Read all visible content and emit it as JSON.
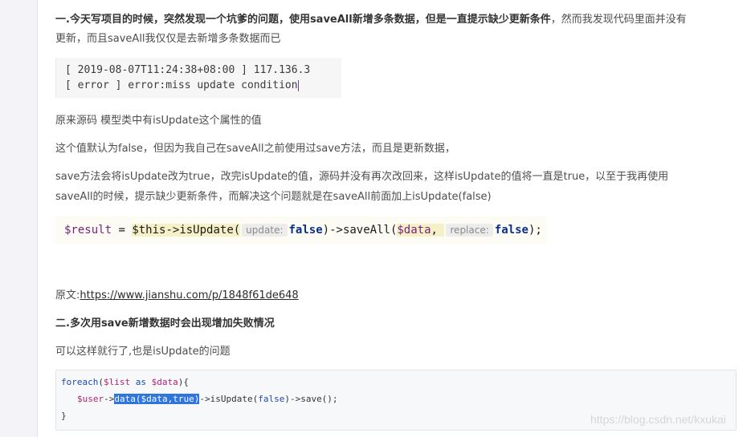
{
  "paragraphs": {
    "p1_bold": "一.今天写项目的时候，突然发现一个坑爹的问题，使用saveAll新增多条数据，但是一直提示缺少更新条件",
    "p1_rest": "，然而我发现代码里面并没有",
    "p1_line2": "更新，而且saveAll我仅仅是去新增多条数据而已",
    "p2": "原来源码 模型类中有isUpdate这个属性的值",
    "p3": "这个值默认为false，但因为我自己在saveAll之前使用过save方法，而且是更新数据，",
    "p4_line1": "save方法会将isUpdate改为true，改完isUpdate的值，源码并没有再次改回来，这样isUpdate的值将一直是true，以至于我再使用",
    "p4_line2": "saveAll的时候，提示缺少更新条件，而解决这个问题就是在saveAll前面加上isUpdate(false)",
    "source_label": "原文:",
    "source_url": "https://www.jianshu.com/p/1848f61de648",
    "heading2": "二.多次用save新增数据时会出现增加失败情况",
    "p5": "可以这样就行了,也是isUpdate的问题"
  },
  "log_block": {
    "line1": "[ 2019-08-07T11:24:38+08:00 ] 117.136.3",
    "line2": "[ error ] error:miss update condition"
  },
  "snippet": {
    "result_var": "$result",
    "equals": " = ",
    "this_call": "$this->isUpdate(",
    "hint_update": "update:",
    "false1": "false",
    "mid": ")->saveAll(",
    "data_var": "$data",
    "comma": ", ",
    "hint_replace": "replace:",
    "false2": "false",
    "end": ");"
  },
  "code2": {
    "l1_kw": "foreach",
    "l1_a": "(",
    "l1_list": "$list",
    "l1_as": " as ",
    "l1_data": "$data",
    "l1_b": "){",
    "l2_user": "$user",
    "l2_arrow": "->",
    "l2_sel": "data($data,true)",
    "l2_rest_a": "->isUpdate(",
    "l2_false": "false",
    "l2_rest_b": ")->save();",
    "l3": "}"
  },
  "watermark": "https://blog.csdn.net/kxukai"
}
